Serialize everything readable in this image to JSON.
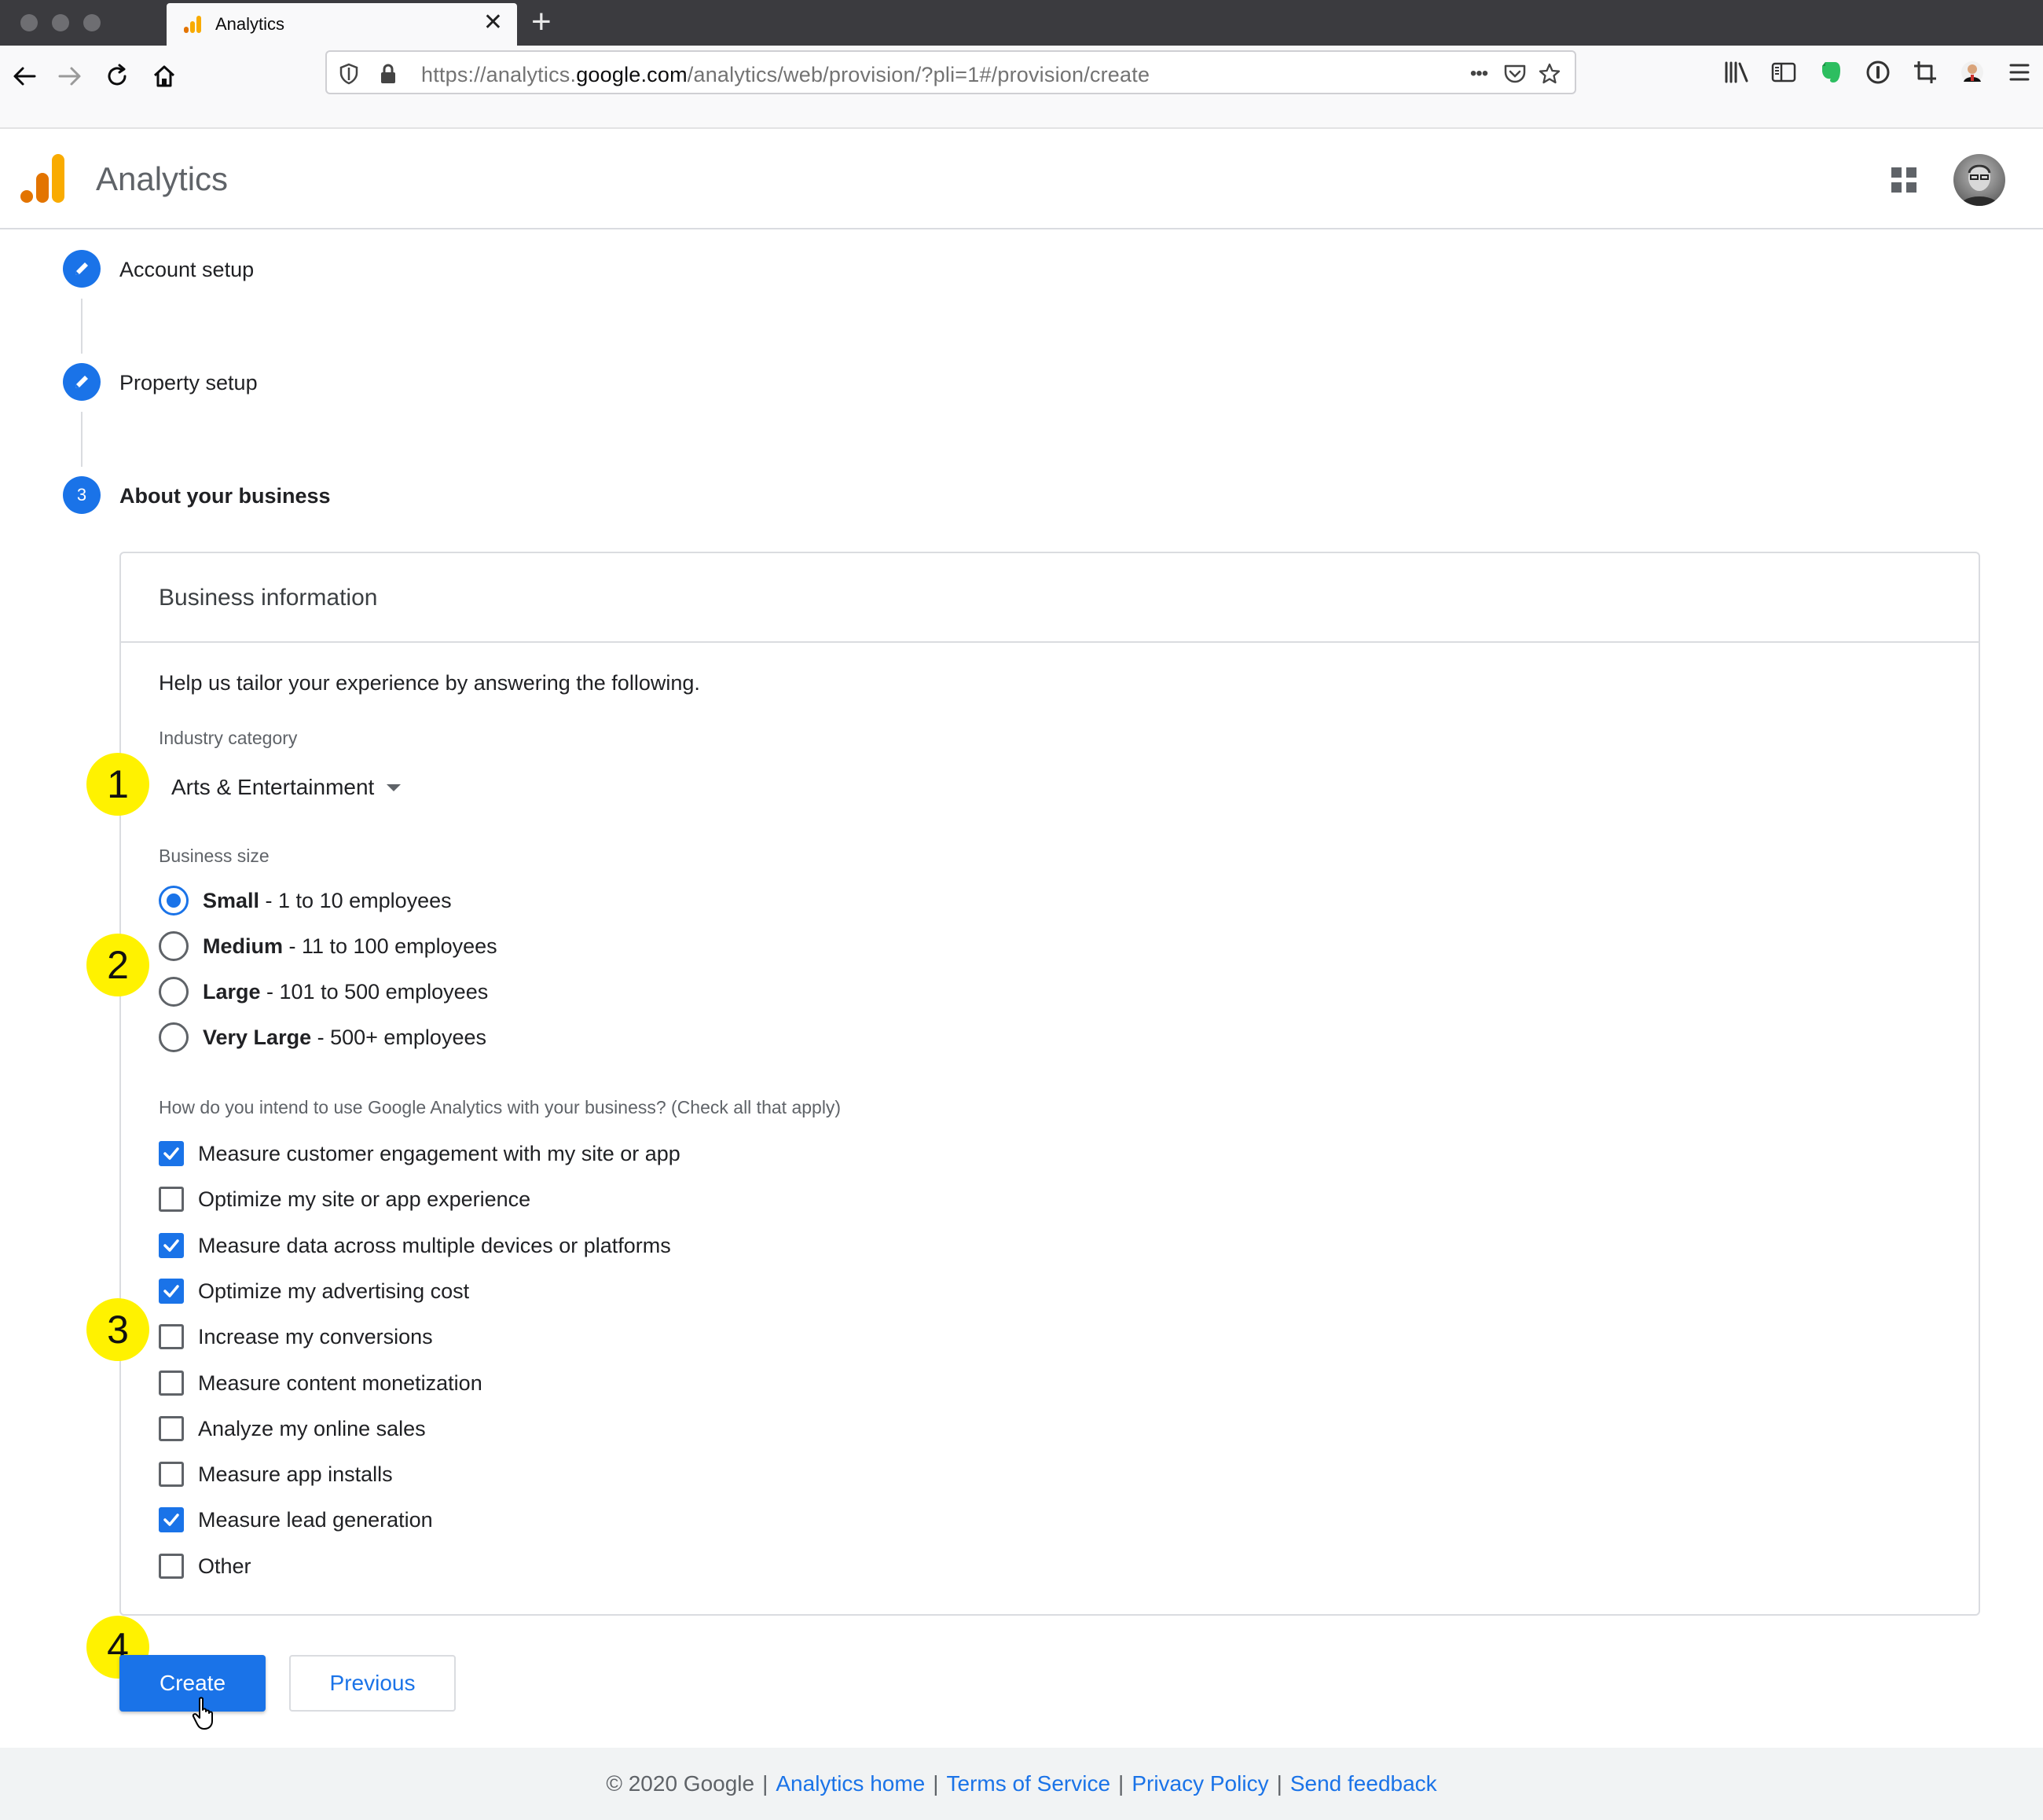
{
  "browser": {
    "tab_title": "Analytics",
    "tab_close": "✕",
    "new_tab": "+",
    "url_prefix": "https://analytics.",
    "url_domain": "google.com",
    "url_path": "/analytics/web/provision/?pli=1#/provision/create",
    "url_more": "•••"
  },
  "app": {
    "title": "Analytics",
    "accent": "#1a73e8",
    "logo_colors": [
      "#f9ab00",
      "#e37400"
    ]
  },
  "stepper": {
    "steps": [
      {
        "label": "Account setup",
        "state": "edit"
      },
      {
        "label": "Property setup",
        "state": "edit"
      },
      {
        "label": "About your business",
        "state": "active",
        "number": "3"
      }
    ]
  },
  "form": {
    "card_title": "Business information",
    "intro": "Help us tailor your experience by answering the following.",
    "industry_label": "Industry category",
    "industry_value": "Arts & Entertainment",
    "size_label": "Business size",
    "sizes": [
      {
        "name": "Small",
        "detail": " - 1 to 10 employees",
        "selected": true
      },
      {
        "name": "Medium",
        "detail": " - 11 to 100 employees",
        "selected": false
      },
      {
        "name": "Large",
        "detail": " - 101 to 500 employees",
        "selected": false
      },
      {
        "name": "Very Large",
        "detail": " - 500+ employees",
        "selected": false
      }
    ],
    "usage_label": "How do you intend to use Google Analytics with your business? (Check all that apply)",
    "usage": [
      {
        "label": "Measure customer engagement with my site or app",
        "checked": true
      },
      {
        "label": "Optimize my site or app experience",
        "checked": false
      },
      {
        "label": "Measure data across multiple devices or platforms",
        "checked": true
      },
      {
        "label": "Optimize my advertising cost",
        "checked": true
      },
      {
        "label": "Increase my conversions",
        "checked": false
      },
      {
        "label": "Measure content monetization",
        "checked": false
      },
      {
        "label": "Analyze my online sales",
        "checked": false
      },
      {
        "label": "Measure app installs",
        "checked": false
      },
      {
        "label": "Measure lead generation",
        "checked": true
      },
      {
        "label": "Other",
        "checked": false
      }
    ]
  },
  "markers": [
    "1",
    "2",
    "3",
    "4"
  ],
  "buttons": {
    "create": "Create",
    "previous": "Previous"
  },
  "footer": {
    "copyright": "© 2020 Google",
    "links": [
      "Analytics home",
      "Terms of Service",
      "Privacy Policy",
      "Send feedback"
    ],
    "separator": "|"
  }
}
